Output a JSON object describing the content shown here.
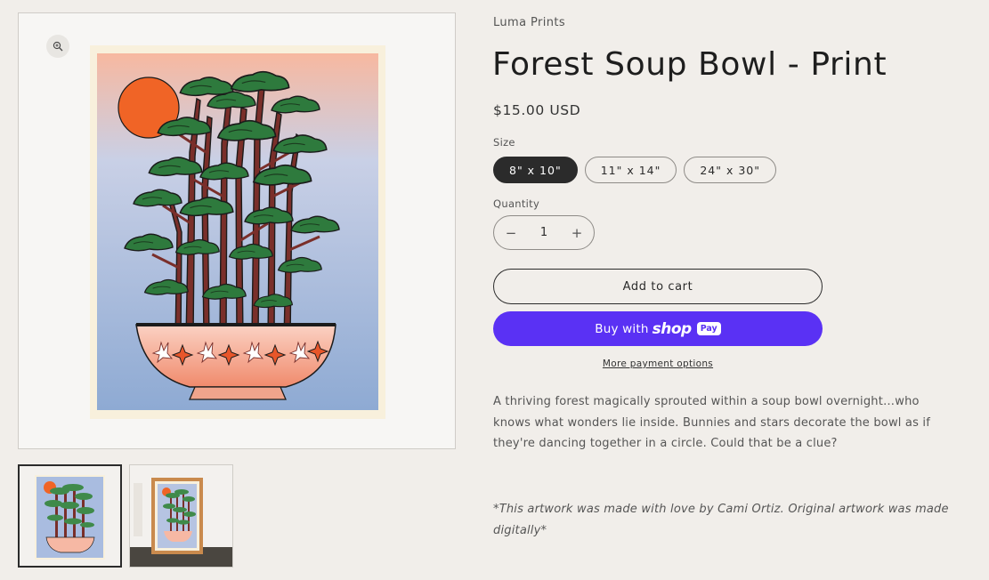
{
  "product": {
    "vendor": "Luma Prints",
    "title": "Forest Soup Bowl - Print",
    "price": "$15.00 USD",
    "size_label": "Size",
    "sizes": [
      "8\" x 10\"",
      "11\" x 14\"",
      "24\" x 30\""
    ],
    "selected_size": "8\" x 10\"",
    "quantity_label": "Quantity",
    "quantity": "1",
    "add_to_cart": "Add to cart",
    "buy_with": "Buy with",
    "shop_word": "shop",
    "pay_badge": "Pay",
    "more_payment": "More payment options",
    "description": "A thriving forest magically sprouted within a soup bowl overnight…who knows what wonders lie inside. Bunnies and stars decorate the bowl as if they're dancing together in a circle. Could that be a clue?",
    "credit": "*This artwork was made with love by Cami Ortiz. Original artwork was  made digitally*"
  },
  "icons": {
    "zoom": "magnify-plus-icon",
    "minus": "minus-icon",
    "plus": "plus-icon"
  },
  "qty_controls": {
    "minus": "−",
    "plus": "+"
  },
  "colors": {
    "background": "#f1eeea",
    "accent_dark": "#2b2b2b",
    "shop_pay": "#5a31f4",
    "sun": "#f06426",
    "tree_green": "#3f8a4a",
    "trunk": "#7a2f2a",
    "bowl": "#f6b8a4"
  }
}
